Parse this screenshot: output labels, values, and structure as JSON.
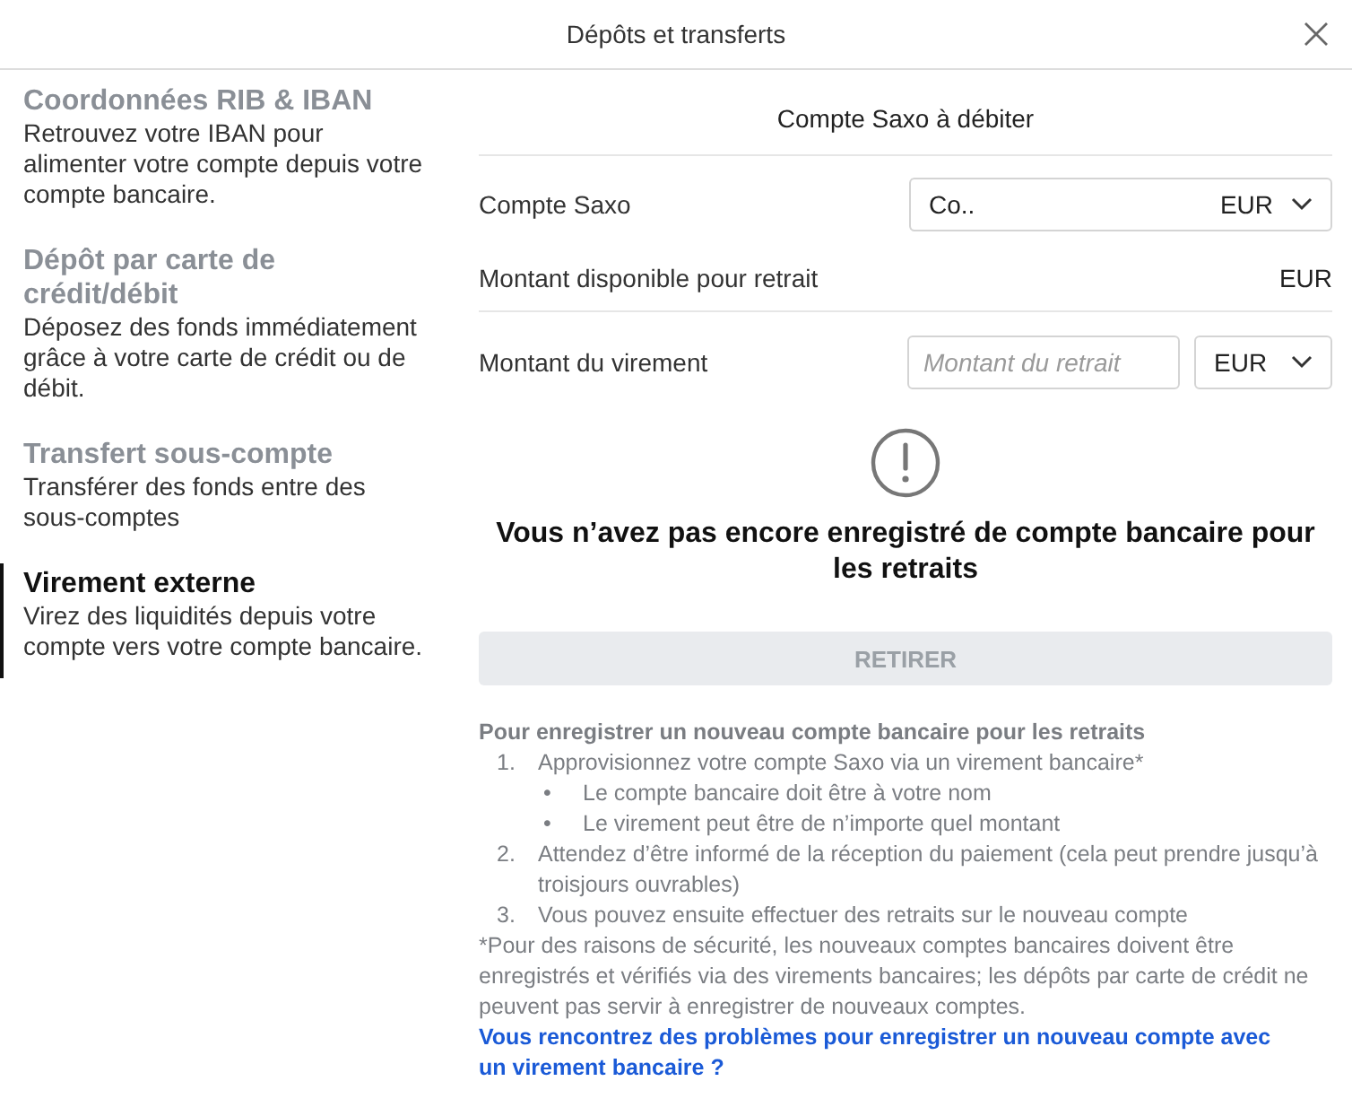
{
  "window": {
    "title": "Dépôts et transferts"
  },
  "sidebar": {
    "items": [
      {
        "title": "Coordonnées RIB & IBAN",
        "description": "Retrouvez votre IBAN pour alimenter votre compte depuis votre compte bancaire.",
        "selected": false
      },
      {
        "title": "Dépôt par carte de crédit/débit",
        "description": "Déposez des fonds immédiatement grâce à votre carte de crédit ou de débit.",
        "selected": false
      },
      {
        "title": "Transfert sous-compte",
        "description": "Transférer des fonds entre des sous-comptes",
        "selected": false
      },
      {
        "title": "Virement externe",
        "description": "Virez des liquidités depuis votre compte vers votre compte bancaire.",
        "selected": true
      }
    ]
  },
  "form": {
    "heading": "Compte Saxo à débiter",
    "rows": [
      {
        "kind": "select",
        "label": "Compte Saxo",
        "value": "Co..",
        "currency": "EUR"
      },
      {
        "kind": "readout",
        "label": "Montant disponible pour retrait",
        "value": "EUR"
      },
      {
        "kind": "amount",
        "label": "Montant du virement",
        "placeholder": "Montant du retrait",
        "currency": "EUR"
      }
    ]
  },
  "notice": {
    "message": "Vous n’avez pas encore enregistré de compte bancaire pour les retraits"
  },
  "withdraw_button": {
    "label": "RETIRER",
    "disabled": true
  },
  "instructions": {
    "heading": "Pour enregistrer un nouveau compte bancaire pour les retraits",
    "steps": [
      {
        "number": "1.",
        "text": "Approvisionnez votre compte Saxo via un virement bancaire*",
        "children": [
          {
            "bullet": "•",
            "text": "Le compte bancaire doit être à votre nom"
          },
          {
            "bullet": "•",
            "text": "Le virement peut être de n’importe quel montant"
          }
        ]
      },
      {
        "number": "2.",
        "text": "Attendez d’être informé de la réception du paiement (cela peut prendre jusqu’à troisjours ouvrables)"
      },
      {
        "number": "3.",
        "text": "Vous pouvez ensuite effectuer des retraits sur le nouveau compte"
      }
    ],
    "footnote": "*Pour des raisons de sécurité, les nouveaux comptes bancaires doivent être enregistrés et vérifiés via des virements bancaires; les dépôts par carte de crédit ne peuvent pas servir à enregistrer de nouveaux comptes.",
    "help_link": "Vous rencontrez des problèmes pour enregistrer un nouveau compte avec un virement bancaire ?"
  }
}
